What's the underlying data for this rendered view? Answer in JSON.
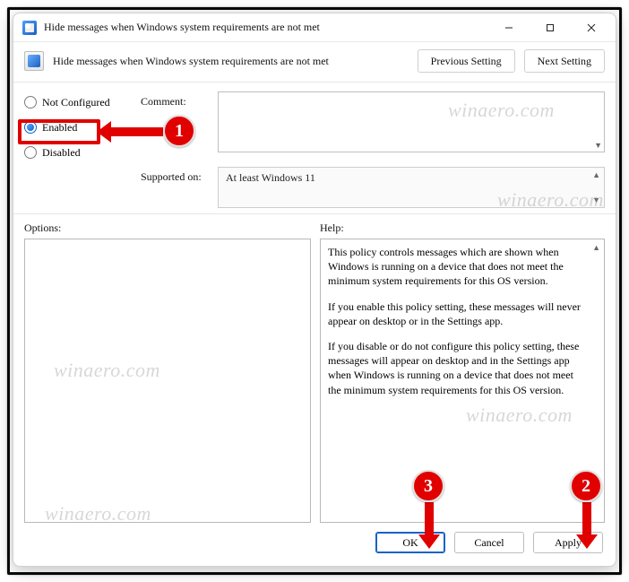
{
  "titlebar": {
    "title": "Hide messages when Windows system requirements are not met"
  },
  "header": {
    "title": "Hide messages when Windows system requirements are not met",
    "prev": "Previous Setting",
    "next": "Next Setting"
  },
  "state": {
    "not_configured": "Not Configured",
    "enabled": "Enabled",
    "disabled": "Disabled"
  },
  "labels": {
    "comment": "Comment:",
    "supported": "Supported on:",
    "options": "Options:",
    "help": "Help:"
  },
  "supported_text": "At least Windows 11",
  "help": {
    "p1": "This policy controls messages which are shown when Windows is running on a device that does not meet the minimum system requirements for this OS version.",
    "p2": "If you enable this policy setting, these messages will never appear on desktop or in the Settings app.",
    "p3": "If you disable or do not configure this policy setting, these messages will appear on desktop and in the Settings app when Windows is running on a device that does not meet the minimum system requirements for this OS version."
  },
  "buttons": {
    "ok": "OK",
    "cancel": "Cancel",
    "apply": "Apply"
  },
  "watermark": "winaero.com",
  "annotations": {
    "b1": "1",
    "b2": "2",
    "b3": "3"
  }
}
